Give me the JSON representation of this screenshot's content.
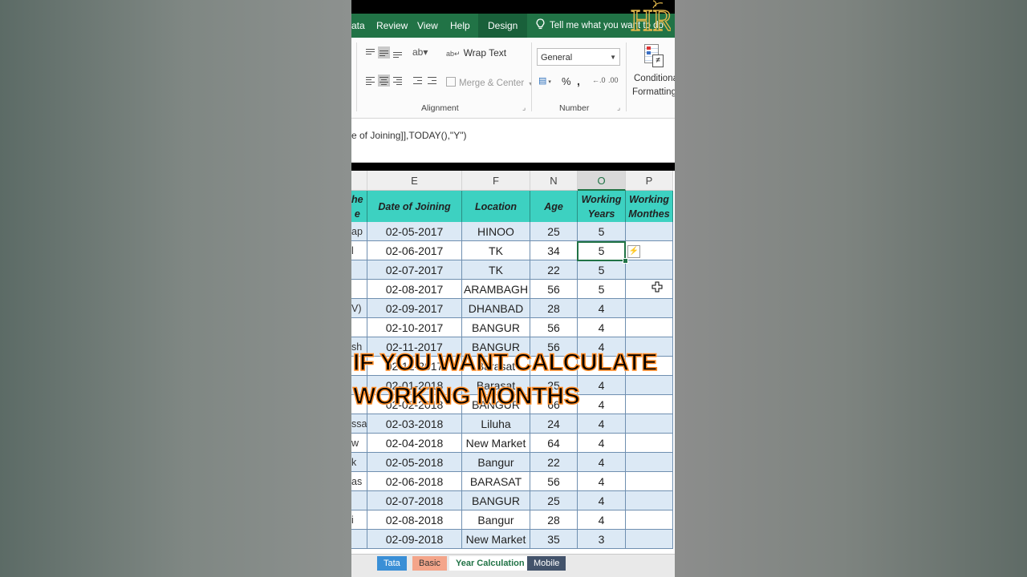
{
  "menu": {
    "tabs": [
      "ata",
      "Review",
      "View",
      "Help",
      "Design"
    ],
    "tell_me": "Tell me what you want to do",
    "logo_text": "HR"
  },
  "ribbon": {
    "wrap_text": "Wrap Text",
    "merge_center": "Merge & Center",
    "alignment_label": "Alignment",
    "number_format": "General",
    "number_label": "Number",
    "percent": "%",
    "comma": ",",
    "conditional": "Conditional",
    "formatting": "Formatting"
  },
  "formula_bar": {
    "text": "e of Joining]],TODAY(),\"Y\")"
  },
  "sheet": {
    "columns": [
      "",
      "E",
      "F",
      "N",
      "O",
      "P"
    ],
    "headers": [
      "he\ne",
      "Date of Joining",
      "Location",
      "Age",
      "Working\nYears",
      "Working\nMonthes"
    ],
    "rows": [
      [
        "ap",
        "02-05-2017",
        "HINOO",
        "25",
        "5",
        ""
      ],
      [
        "l",
        "02-06-2017",
        "TK",
        "34",
        "5",
        ""
      ],
      [
        "",
        "02-07-2017",
        "TK",
        "22",
        "5",
        ""
      ],
      [
        "",
        "02-08-2017",
        "ARAMBAGH",
        "56",
        "5",
        ""
      ],
      [
        "V)",
        "02-09-2017",
        "DHANBAD",
        "28",
        "4",
        ""
      ],
      [
        "",
        "02-10-2017",
        "BANGUR",
        "56",
        "4",
        ""
      ],
      [
        "sh",
        "02-11-2017",
        "BANGUR",
        "56",
        "4",
        ""
      ],
      [
        "",
        "02-12-2017",
        "Barasat",
        "",
        "4",
        ""
      ],
      [
        "",
        "02-01-2018",
        "Barasat",
        "25",
        "4",
        ""
      ],
      [
        "",
        "02-02-2018",
        "BANGUR",
        "66",
        "4",
        ""
      ],
      [
        "ssain",
        "02-03-2018",
        "Liluha",
        "24",
        "4",
        ""
      ],
      [
        "w",
        "02-04-2018",
        "New Market",
        "64",
        "4",
        ""
      ],
      [
        "k",
        "02-05-2018",
        "Bangur",
        "22",
        "4",
        ""
      ],
      [
        "as",
        "02-06-2018",
        "BARASAT",
        "56",
        "4",
        ""
      ],
      [
        "",
        "02-07-2018",
        "BANGUR",
        "25",
        "4",
        ""
      ],
      [
        "i",
        "02-08-2018",
        "Bangur",
        "28",
        "4",
        ""
      ],
      [
        "",
        "02-09-2018",
        "New Market",
        "35",
        "3",
        ""
      ]
    ]
  },
  "overlay": {
    "line1": "IF YOU WANT CALCULATE",
    "line2": "WORKING MONTHS"
  },
  "sheet_tabs": [
    "Tata",
    "Basic",
    "Year Calculation",
    "Mobile"
  ],
  "colors": {
    "excel_green": "#217346",
    "table_header": "#3dd1c1",
    "band": "#dce9f5",
    "overlay_stroke": "#ff8a22"
  }
}
